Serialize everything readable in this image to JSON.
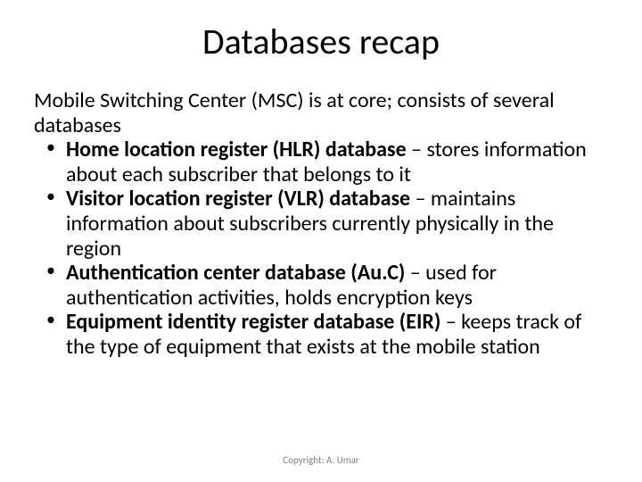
{
  "title": "Databases recap",
  "intro": "Mobile Switching Center (MSC) is at core; consists of several databases",
  "bullets": [
    {
      "bold": "Home location register (HLR) database",
      "rest": " – stores information about each subscriber that belongs to it"
    },
    {
      "bold": "Visitor location register (VLR) database",
      "rest": " – maintains information about subscribers currently physically in the region"
    },
    {
      "bold": "Authentication center database (Au.C)",
      "rest": " – used for authentication activities, holds encryption keys"
    },
    {
      "bold": "Equipment identity register database (EIR)",
      "rest": " – keeps track of the type of equipment that exists at the mobile station"
    }
  ],
  "footer": "Copyright: A. Umar"
}
